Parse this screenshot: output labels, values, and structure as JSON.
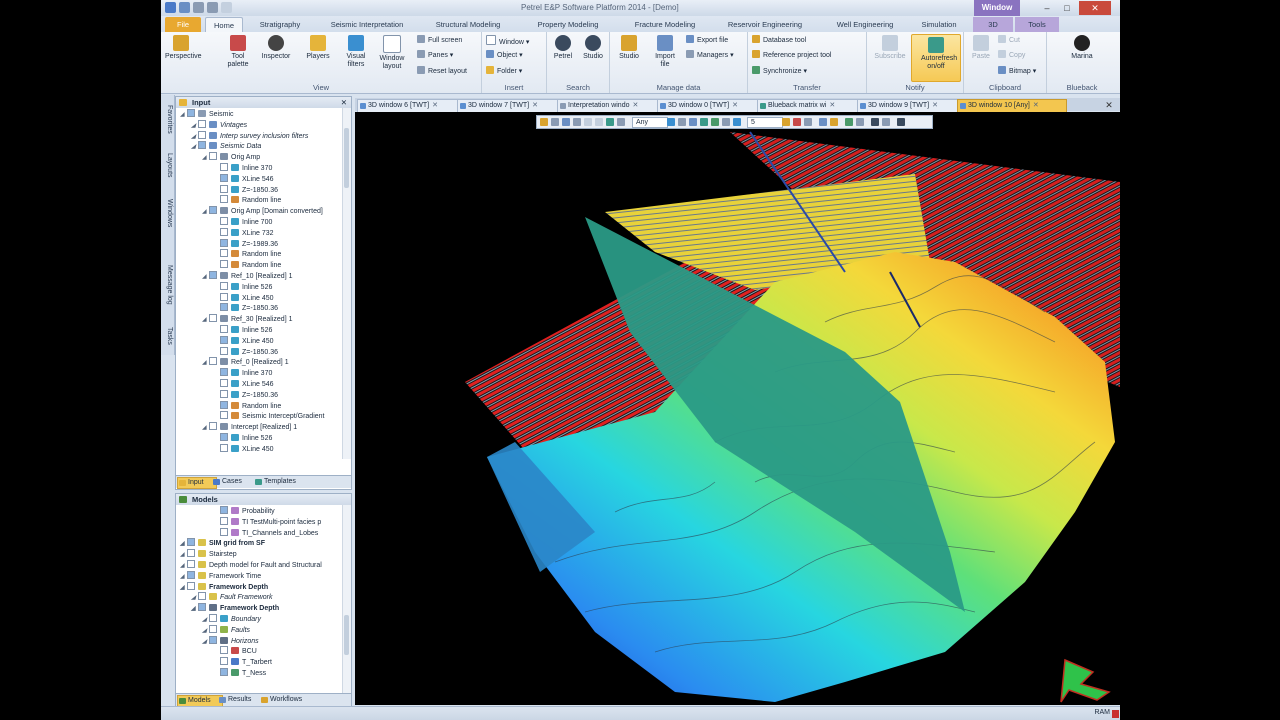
{
  "window": {
    "title": "Petrel E&P Software Platform 2014 - [Demo]",
    "context_label": "Window"
  },
  "ribbon_tabs": [
    {
      "id": "file",
      "label": "File"
    },
    {
      "id": "home",
      "label": "Home"
    },
    {
      "id": "strat",
      "label": "Stratigraphy"
    },
    {
      "id": "seis",
      "label": "Seismic Interpretation"
    },
    {
      "id": "struct",
      "label": "Structural Modeling"
    },
    {
      "id": "prop",
      "label": "Property Modeling"
    },
    {
      "id": "frac",
      "label": "Fracture Modeling"
    },
    {
      "id": "res",
      "label": "Reservoir Engineering"
    },
    {
      "id": "well",
      "label": "Well Engineering"
    },
    {
      "id": "sim",
      "label": "Simulation"
    },
    {
      "id": "3d",
      "label": "3D"
    },
    {
      "id": "tools",
      "label": "Tools"
    }
  ],
  "ribbon": {
    "view": {
      "label": "View",
      "perspective": "Perspective",
      "tool_palette": "Tool palette",
      "inspector": "Inspector",
      "players": "Players",
      "visual_filters": "Visual filters",
      "window_layout": "Window layout",
      "full_screen": "Full screen",
      "panes": "Panes",
      "reset_layout": "Reset layout"
    },
    "insert": {
      "label": "Insert",
      "window": "Window",
      "object": "Object",
      "folder": "Folder"
    },
    "search": {
      "label": "Search",
      "petrel": "Petrel",
      "studio": "Studio"
    },
    "manage": {
      "label": "Manage data",
      "studio": "Studio",
      "import_file": "Import file",
      "export_file": "Export file",
      "managers": "Managers"
    },
    "transfer": {
      "label": "Transfer",
      "database_tool": "Database tool",
      "reference_project_tool": "Reference project tool",
      "synchronize": "Synchronize"
    },
    "notify": {
      "label": "Notify",
      "subscribe": "Subscribe",
      "autorefresh": "Autorefresh on/off"
    },
    "clipboard": {
      "label": "Clipboard",
      "paste": "Paste",
      "cut": "Cut",
      "copy": "Copy",
      "bitmap": "Bitmap"
    },
    "blueback": {
      "label": "Blueback",
      "marina": "Marina"
    }
  },
  "side_strip": [
    "Favorites",
    "Layouts",
    "Windows",
    "Message log",
    "Tasks"
  ],
  "input_pane": {
    "title": "Input",
    "rows": [
      {
        "text": "Seismic",
        "indent": 0,
        "icon": "#8a9bb3"
      },
      {
        "text": "Vintages",
        "indent": 1,
        "icon": "#6a8fc4",
        "style": "ital"
      },
      {
        "text": "Interp survey inclusion filters",
        "indent": 1,
        "icon": "#6a8fc4",
        "style": "ital"
      },
      {
        "text": "Seismic Data",
        "indent": 1,
        "icon": "#6a8fc4",
        "style": "ital"
      },
      {
        "text": "Orig Amp",
        "indent": 2,
        "icon": "#7d8ea6"
      },
      {
        "text": "Inline 370",
        "indent": 3,
        "icon": "#3aa0c8"
      },
      {
        "text": "XLine 546",
        "indent": 3,
        "icon": "#3aa0c8"
      },
      {
        "text": "Z=-1850.36",
        "indent": 3,
        "icon": "#3aa0c8"
      },
      {
        "text": "Random line",
        "indent": 3,
        "icon": "#d48a3a"
      },
      {
        "text": "Orig Amp [Domain converted]",
        "indent": 2,
        "icon": "#7d8ea6"
      },
      {
        "text": "Inline 700",
        "indent": 3,
        "icon": "#3aa0c8"
      },
      {
        "text": "XLine 732",
        "indent": 3,
        "icon": "#3aa0c8"
      },
      {
        "text": "Z=-1989.36",
        "indent": 3,
        "icon": "#3aa0c8"
      },
      {
        "text": "Random line",
        "indent": 3,
        "icon": "#d48a3a"
      },
      {
        "text": "Random line",
        "indent": 3,
        "icon": "#d48a3a"
      },
      {
        "text": "Ref_10 [Realized] 1",
        "indent": 2,
        "icon": "#7d8ea6"
      },
      {
        "text": "Inline 526",
        "indent": 3,
        "icon": "#3aa0c8"
      },
      {
        "text": "XLine 450",
        "indent": 3,
        "icon": "#3aa0c8"
      },
      {
        "text": "Z=-1850.36",
        "indent": 3,
        "icon": "#3aa0c8"
      },
      {
        "text": "Ref_30 [Realized] 1",
        "indent": 2,
        "icon": "#7d8ea6"
      },
      {
        "text": "Inline 526",
        "indent": 3,
        "icon": "#3aa0c8"
      },
      {
        "text": "XLine 450",
        "indent": 3,
        "icon": "#3aa0c8"
      },
      {
        "text": "Z=-1850.36",
        "indent": 3,
        "icon": "#3aa0c8"
      },
      {
        "text": "Ref_0 [Realized] 1",
        "indent": 2,
        "icon": "#7d8ea6"
      },
      {
        "text": "Inline 370",
        "indent": 3,
        "icon": "#3aa0c8"
      },
      {
        "text": "XLine 546",
        "indent": 3,
        "icon": "#3aa0c8"
      },
      {
        "text": "Z=-1850.36",
        "indent": 3,
        "icon": "#3aa0c8"
      },
      {
        "text": "Random line",
        "indent": 3,
        "icon": "#d48a3a"
      },
      {
        "text": "Seismic Intercept/Gradient",
        "indent": 3,
        "icon": "#d48a3a"
      },
      {
        "text": "Intercept [Realized] 1",
        "indent": 2,
        "icon": "#7d8ea6"
      },
      {
        "text": "Inline 526",
        "indent": 3,
        "icon": "#3aa0c8"
      },
      {
        "text": "XLine 450",
        "indent": 3,
        "icon": "#3aa0c8"
      }
    ],
    "tabs": [
      "Input",
      "Cases",
      "Templates"
    ]
  },
  "models_pane": {
    "title": "Models",
    "rows": [
      {
        "text": "Probability",
        "indent": 3,
        "icon": "#b07ac8"
      },
      {
        "text": "TI TestMulti-point facies p",
        "indent": 3,
        "icon": "#b07ac8"
      },
      {
        "text": "TI_Channels and_Lobes",
        "indent": 3,
        "icon": "#b07ac8"
      },
      {
        "text": "SIM grid from SF",
        "indent": 0,
        "icon": "#d9c24a",
        "style": "bold"
      },
      {
        "text": "Stairstep",
        "indent": 0,
        "icon": "#d9c24a"
      },
      {
        "text": "Depth model for Fault and Structural",
        "indent": 0,
        "icon": "#d9c24a"
      },
      {
        "text": "Framework Time",
        "indent": 0,
        "icon": "#d9c24a"
      },
      {
        "text": "Framework Depth",
        "indent": 0,
        "icon": "#d9c24a",
        "style": "bold"
      },
      {
        "text": "Fault Framework",
        "indent": 1,
        "icon": "#d9c24a",
        "style": "ital"
      },
      {
        "text": "Framework Depth",
        "indent": 1,
        "icon": "#5f6f86",
        "style": "bold"
      },
      {
        "text": "Boundary",
        "indent": 2,
        "icon": "#3aa0c8",
        "style": "ital"
      },
      {
        "text": "Faults",
        "indent": 2,
        "icon": "#8fb34a",
        "style": "ital"
      },
      {
        "text": "Horizons",
        "indent": 2,
        "icon": "#5f6f86",
        "style": "ital"
      },
      {
        "text": "BCU",
        "indent": 3,
        "icon": "#c84a4a"
      },
      {
        "text": "T_Tarbert",
        "indent": 3,
        "icon": "#4a7ac8"
      },
      {
        "text": "T_Ness",
        "indent": 3,
        "icon": "#4a9a6a"
      }
    ],
    "tabs": [
      "Models",
      "Results",
      "Workflows"
    ]
  },
  "doc_tabs": [
    {
      "label": "3D window 6 [TWT]",
      "active": false
    },
    {
      "label": "3D window 7 [TWT]",
      "active": false
    },
    {
      "label": "Interpretation windo",
      "active": false
    },
    {
      "label": "3D window 0 [TWT]",
      "active": false
    },
    {
      "label": "Blueback matrix wi",
      "active": false
    },
    {
      "label": "3D window 9 [TWT]",
      "active": false
    },
    {
      "label": "3D window 10 [Any]",
      "active": true
    }
  ],
  "viewer_toolbar": {
    "domain_value": "Any",
    "zscale_value": "5"
  },
  "status": {
    "ram": "RAM"
  },
  "colors": {
    "accent": "#e8a830",
    "active_tab": "#f3c64f",
    "ribbon_bg": "#e2e9f2"
  }
}
